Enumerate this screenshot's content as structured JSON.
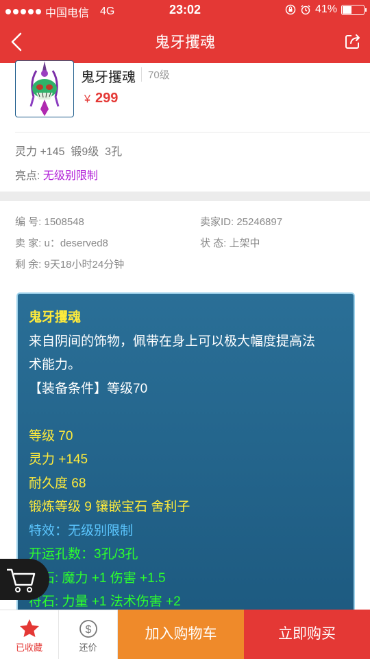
{
  "status_bar": {
    "carrier": "中国电信",
    "network": "4G",
    "time": "23:02",
    "battery": "41%"
  },
  "nav": {
    "title": "鬼牙攫魂",
    "back_icon": "chevron-left-icon",
    "share_icon": "share-icon"
  },
  "item": {
    "name": "鬼牙攫魂",
    "level": "70级",
    "currency": "￥",
    "price": "299",
    "attrs": "灵力 +145  锻9级  3孔",
    "highlight_label": "亮点: ",
    "highlight_value": "无级别限制"
  },
  "info": {
    "id_label": "编  号: 1508548",
    "seller_id_label": "卖家ID: 25246897",
    "seller_label": "卖  家: u：deserved8",
    "state_label": "状  态: 上架中",
    "remaining_label": "剩  余: 9天18小时24分钟"
  },
  "description": {
    "title": "鬼牙攫魂",
    "line1": "来自阴间的饰物，佩带在身上可以极大幅度提高法",
    "line2": "术能力。",
    "line3": "【装备条件】等级70",
    "stat1": "等级 70",
    "stat2": "灵力 +145",
    "stat3": "耐久度 68",
    "stat4": "锻炼等级 9 镶嵌宝石 舍利子",
    "effect": "特效：无级别限制",
    "holes": "开运孔数：3孔/3孔",
    "stone1": "符石: 魔力 +1 伤害 +1.5",
    "stone2": "符石: 力量 +1 法术伤害 +2"
  },
  "bottom": {
    "favorited": "已收藏",
    "bargain": "还价",
    "add_cart": "加入购物车",
    "buy_now": "立即购买"
  },
  "colors": {
    "brand_red": "#e43835",
    "cart_orange": "#ef8a2a",
    "desc_bg": "#2a6f97"
  }
}
